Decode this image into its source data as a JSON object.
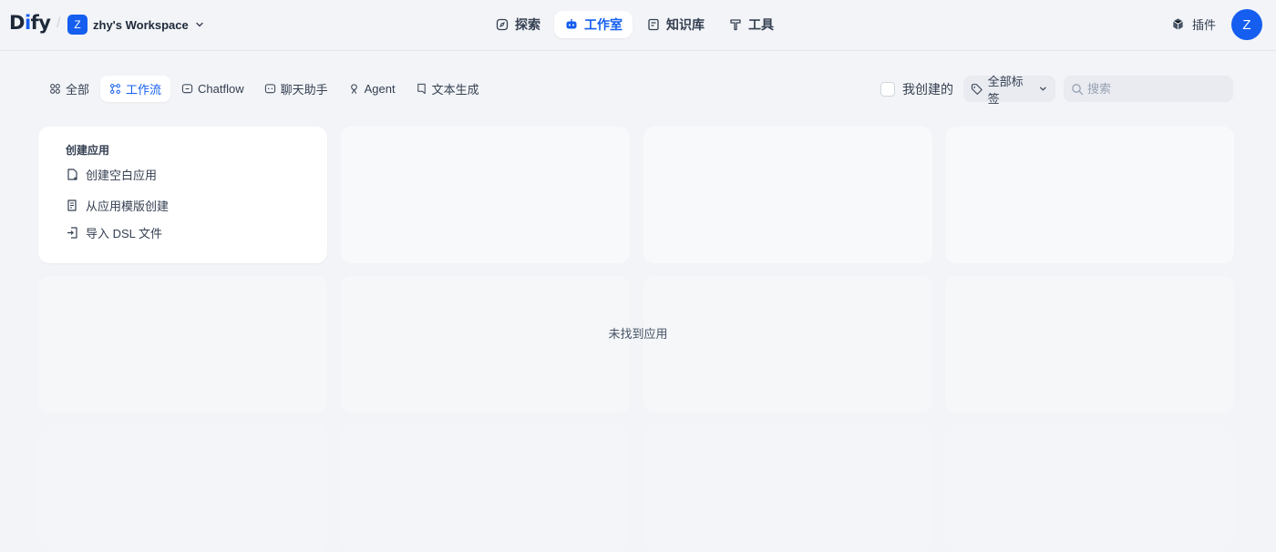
{
  "brand": {
    "logo_text_a": "D",
    "logo_text_b": "i",
    "logo_text_c": "fy"
  },
  "workspace": {
    "avatar_letter": "Z",
    "name": "zhy's Workspace"
  },
  "nav": [
    {
      "label": "探索",
      "icon": "compass-icon"
    },
    {
      "label": "工作室",
      "icon": "robot-icon",
      "active": true
    },
    {
      "label": "知识库",
      "icon": "book-icon"
    },
    {
      "label": "工具",
      "icon": "hammer-icon"
    }
  ],
  "plugins_label": "插件",
  "user": {
    "avatar_letter": "Z"
  },
  "tabs": [
    {
      "label": "全部",
      "icon": "grid-icon"
    },
    {
      "label": "工作流",
      "icon": "workflow-icon",
      "active": true
    },
    {
      "label": "Chatflow",
      "icon": "chatflow-icon"
    },
    {
      "label": "聊天助手",
      "icon": "chat-icon"
    },
    {
      "label": "Agent",
      "icon": "agent-icon"
    },
    {
      "label": "文本生成",
      "icon": "text-icon"
    }
  ],
  "filters": {
    "created_by_me": "我创建的",
    "tags": "全部标签",
    "search_placeholder": "搜索"
  },
  "create_card": {
    "title": "创建应用",
    "items": [
      "创建空白应用",
      "从应用模版创建",
      "导入 DSL 文件"
    ]
  },
  "empty_message": "未找到应用",
  "colors": {
    "accent": "#155eef",
    "background": "#f2f4f7"
  }
}
